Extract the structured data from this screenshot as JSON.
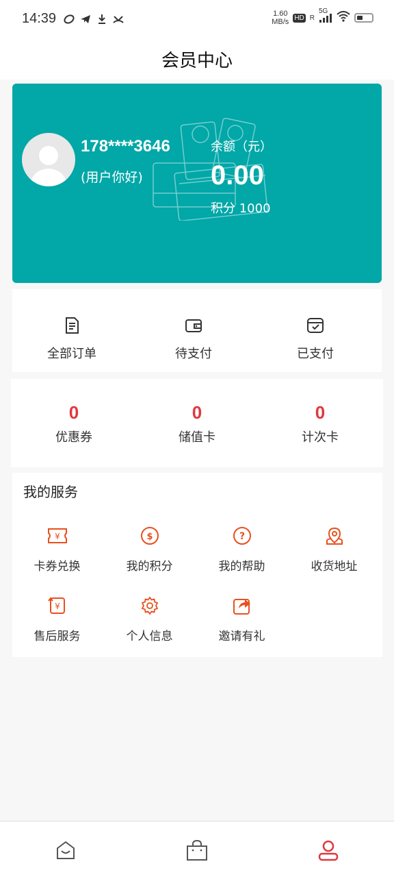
{
  "status_bar": {
    "time": "14:39",
    "net_speed_value": "1.60",
    "net_speed_unit": "MB/s",
    "hd": "HD",
    "sim": "R",
    "network": "5G"
  },
  "header": {
    "title": "会员中心"
  },
  "member_card": {
    "phone": "178****3646",
    "greeting": "(用户你好)",
    "balance_label": "余额（元）",
    "balance_value": "0.00",
    "points_label": "积分 1000"
  },
  "orders": {
    "items": [
      {
        "label": "全部订单",
        "icon": "order-list-icon"
      },
      {
        "label": "待支付",
        "icon": "wallet-icon"
      },
      {
        "label": "已支付",
        "icon": "paid-box-icon"
      }
    ]
  },
  "stats": {
    "items": [
      {
        "value": "0",
        "label": "优惠券"
      },
      {
        "value": "0",
        "label": "储值卡"
      },
      {
        "value": "0",
        "label": "计次卡"
      }
    ]
  },
  "services": {
    "title": "我的服务",
    "items": [
      {
        "label": "卡券兑换",
        "icon": "coupon-exchange-icon"
      },
      {
        "label": "我的积分",
        "icon": "points-coin-icon"
      },
      {
        "label": "我的帮助",
        "icon": "help-icon"
      },
      {
        "label": "收货地址",
        "icon": "address-pin-icon"
      },
      {
        "label": "售后服务",
        "icon": "after-sales-icon"
      },
      {
        "label": "个人信息",
        "icon": "settings-gear-icon"
      },
      {
        "label": "邀请有礼",
        "icon": "share-invite-icon"
      }
    ]
  },
  "tabs": [
    {
      "icon": "home-icon",
      "active": false
    },
    {
      "icon": "shopping-bag-icon",
      "active": false
    },
    {
      "icon": "profile-icon",
      "active": true
    }
  ],
  "colors": {
    "card_bg": "#02a7a8",
    "accent_orange": "#e8501e",
    "stat_red": "#e0383e",
    "tab_active": "#e0383e",
    "tab_inactive": "#555555"
  }
}
